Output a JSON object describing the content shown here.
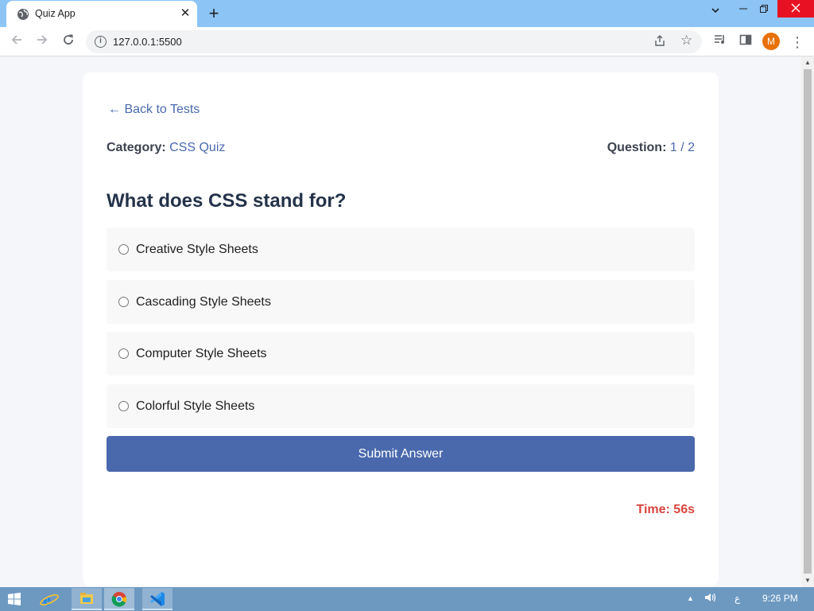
{
  "browser": {
    "tab_title": "Quiz App",
    "tab_close_glyph": "✕",
    "new_tab_glyph": "+",
    "url": "127.0.0.1:5500",
    "profile_initial": "M"
  },
  "page": {
    "back_link": "← Back to Tests",
    "category_label": "Category:",
    "category_value": "CSS Quiz",
    "question_label": "Question:",
    "question_value": "1 / 2",
    "question_text": "What does CSS stand for?",
    "options": [
      {
        "label": "Creative Style Sheets"
      },
      {
        "label": "Cascading Style Sheets"
      },
      {
        "label": "Computer Style Sheets"
      },
      {
        "label": "Colorful Style Sheets"
      }
    ],
    "submit_label": "Submit Answer",
    "timer": "Time: 56s"
  },
  "taskbar": {
    "lang": "ع",
    "clock": "9:26 PM"
  },
  "colors": {
    "accent": "#4a69ad",
    "timer": "#d9453d",
    "titlebar": "#8cc4f5",
    "taskbar": "#6d99c1"
  },
  "icons": [
    "globe-icon",
    "close-icon",
    "plus-icon",
    "chevron-down-icon",
    "minimize-icon",
    "maximize-icon",
    "back-arrow-icon",
    "forward-arrow-icon",
    "reload-icon",
    "info-icon",
    "share-icon",
    "star-icon",
    "media-icon",
    "side-panel-icon",
    "kebab-menu-icon",
    "windows-start-icon",
    "ie-icon",
    "file-explorer-icon",
    "chrome-icon",
    "vscode-icon",
    "volume-icon"
  ]
}
